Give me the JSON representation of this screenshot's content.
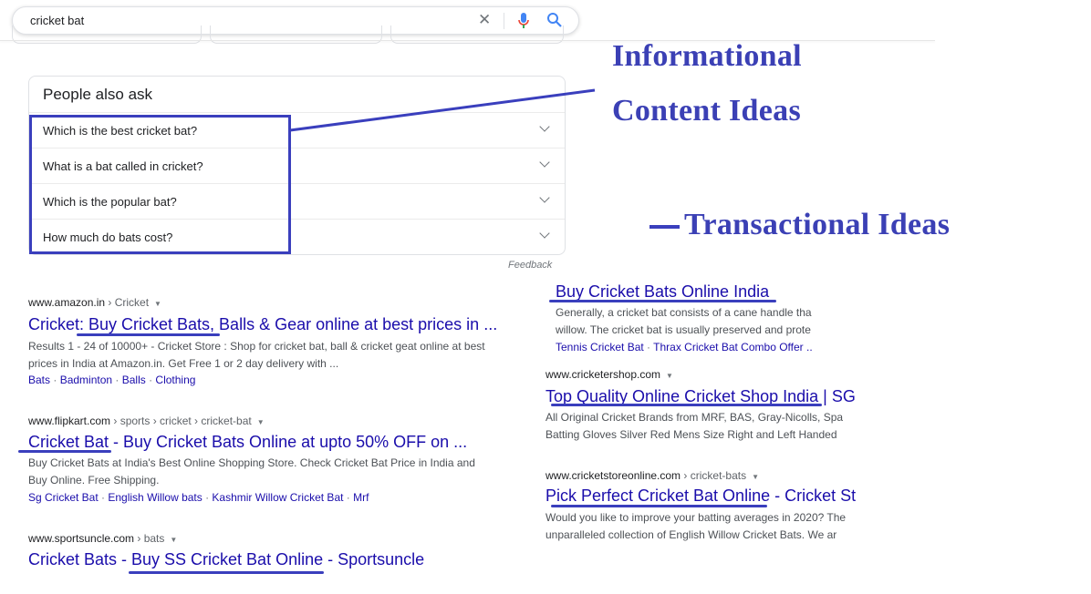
{
  "search": {
    "query": "cricket bat",
    "clear_icon": "close-icon",
    "mic_icon": "microphone-icon",
    "search_icon": "search-icon"
  },
  "paa": {
    "title": "People also ask",
    "questions": [
      "Which is the best cricket bat?",
      "What is a bat called in cricket?",
      "Which is the popular bat?",
      "How much do bats cost?"
    ],
    "feedback": "Feedback"
  },
  "results_left": [
    {
      "site": "www.amazon.in",
      "crumb": " › Cricket",
      "title": "Cricket: Buy Cricket Bats, Balls & Gear online at best prices in ...",
      "snippet": [
        "Results 1 - 24 of 10000+ - Cricket Store : Shop for cricket bat, ball & cricket geat online at best",
        "prices in India at Amazon.in. Get Free 1 or 2 day delivery with ..."
      ],
      "links": [
        "Bats",
        "Badminton",
        "Balls",
        "Clothing"
      ]
    },
    {
      "site": "www.flipkart.com",
      "crumb": " › sports › cricket › cricket-bat",
      "title": "Cricket Bat - Buy Cricket Bats Online at upto 50% OFF on ...",
      "snippet": [
        "Buy Cricket Bats at India's Best Online Shopping Store. Check Cricket Bat Price in India and",
        "Buy Online. Free Shipping."
      ],
      "links": [
        "Sg Cricket Bat",
        "English Willow bats",
        "Kashmir Willow Cricket Bat",
        "Mrf"
      ]
    },
    {
      "site": "www.sportsuncle.com",
      "crumb": " › bats",
      "title": "Cricket Bats - Buy SS Cricket Bat Online - Sportsuncle"
    }
  ],
  "results_right": [
    {
      "title": "Buy Cricket Bats Online India",
      "snippet": [
        "Generally, a cricket bat consists of a cane handle tha",
        "willow. The cricket bat is usually preserved and prote"
      ],
      "links": [
        "Tennis Cricket Bat",
        "Thrax Cricket Bat Combo Offer .."
      ]
    },
    {
      "site": "www.cricketershop.com",
      "crumb": "",
      "title": "Top Quality Online Cricket Shop India | SG",
      "snippet": [
        "All Original Cricket Brands from MRF, BAS, Gray-Nicolls, Spa",
        "Batting Gloves Silver Red Mens Size Right and Left Handed"
      ]
    },
    {
      "site": "www.cricketstoreonline.com",
      "crumb": " › cricket-bats",
      "title": "Pick Perfect Cricket Bat Online - Cricket St",
      "snippet": [
        "Would you like to improve your batting averages in 2020? The",
        "unparalleled collection of English Willow Cricket Bats. We ar"
      ]
    }
  ],
  "annotations": {
    "informational_1": "Informational",
    "informational_2": "Content Ideas",
    "transactional": "Transactional Ideas",
    "color": "#3b40b5"
  }
}
